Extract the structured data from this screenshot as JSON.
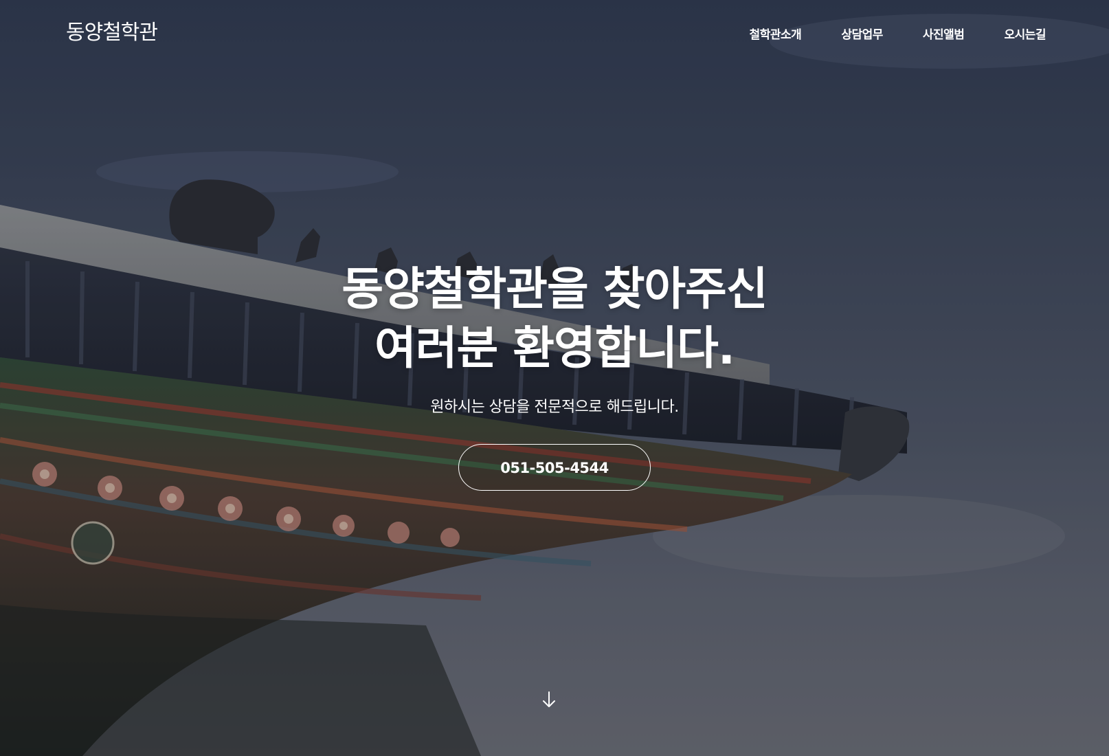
{
  "site": {
    "logo_text": "동양철학관"
  },
  "nav": {
    "items": [
      {
        "label": "철학관소개"
      },
      {
        "label": "상담업무"
      },
      {
        "label": "사진앨범"
      },
      {
        "label": "오시는길"
      }
    ]
  },
  "hero": {
    "title_line1": "동양철학관을 찾아주신",
    "title_line2": "여러분 환영합니다.",
    "subtitle": "원하시는 상담을 전문적으로 해드립니다.",
    "phone": "051-505-4544"
  },
  "icons": {
    "scroll": "arrow-down-icon"
  },
  "colors": {
    "text": "#ffffff",
    "sky_top": "#2f3a50",
    "sky_bottom": "#6b6e76"
  }
}
